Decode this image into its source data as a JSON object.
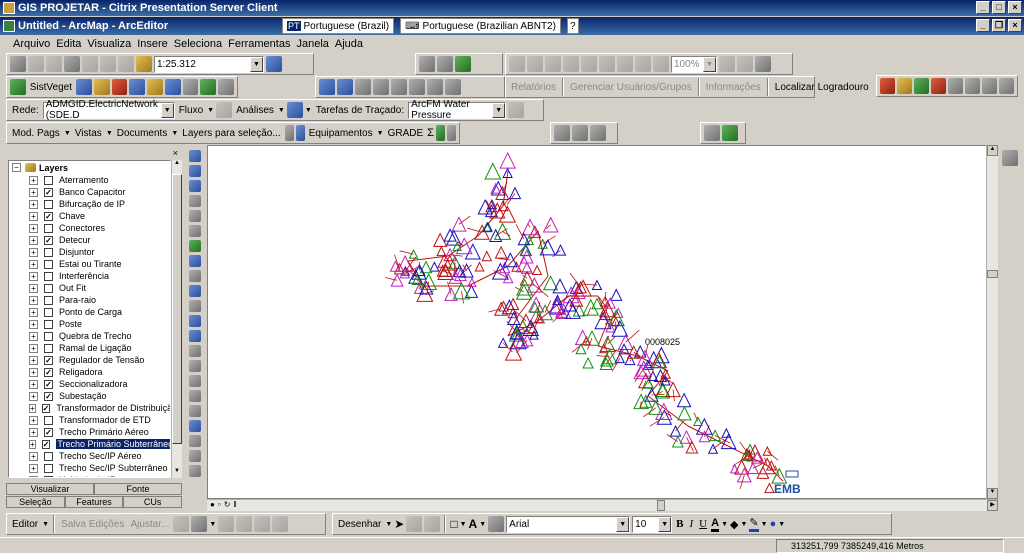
{
  "outer_title": "GIS PROJETAR - Citrix Presentation Server Client",
  "app_title": "Untitled - ArcMap - ArcEditor",
  "language_bar": [
    {
      "code": "PT",
      "label": "Portuguese (Brazil)"
    },
    {
      "code": "",
      "label": "Portuguese (Brazilian ABNT2)"
    }
  ],
  "menus": [
    "Arquivo",
    "Edita",
    "Visualiza",
    "Insere",
    "Seleciona",
    "Ferramentas",
    "Janela",
    "Ajuda"
  ],
  "standard_toolbar": {
    "scale": "1:25.312"
  },
  "sistveget_toolbar": {
    "label": "SistVeget"
  },
  "right_toolbar": {
    "zoom": "100%",
    "items": [
      "Relatórios",
      "Gerenciar Usuários/Grupos",
      "Informações",
      "Localizar Logradouro"
    ]
  },
  "network_toolbar": {
    "rede_label": "Rede:",
    "network": "ADMGID.ElectricNetwork (SDE.D",
    "fluxo": "Fluxo",
    "analises": "Análises",
    "tarefas_label": "Tarefas de Traçado:",
    "tarefa": "ArcFM Water Pressure"
  },
  "mod_toolbar": {
    "items": [
      "Mod. Pags",
      "Vistas",
      "Documents",
      "Layers para seleção...",
      "Equipamentos",
      "GRADE"
    ]
  },
  "toc": {
    "root": "Layers",
    "layers": [
      {
        "name": "Aterramento",
        "checked": false
      },
      {
        "name": "Banco Capacitor",
        "checked": true
      },
      {
        "name": "Bifurcação de IP",
        "checked": false
      },
      {
        "name": "Chave",
        "checked": true
      },
      {
        "name": "Conectores",
        "checked": false
      },
      {
        "name": "Detecur",
        "checked": true
      },
      {
        "name": "Disjuntor",
        "checked": false
      },
      {
        "name": "Estai ou Tirante",
        "checked": false
      },
      {
        "name": "Interferência",
        "checked": false
      },
      {
        "name": "Out Fit",
        "checked": false
      },
      {
        "name": "Para-raio",
        "checked": false
      },
      {
        "name": "Ponto de Carga",
        "checked": false
      },
      {
        "name": "Poste",
        "checked": false
      },
      {
        "name": "Quebra de Trecho",
        "checked": false
      },
      {
        "name": "Ramal de Ligação",
        "checked": false
      },
      {
        "name": "Regulador de Tensão",
        "checked": true
      },
      {
        "name": "Religadora",
        "checked": true
      },
      {
        "name": "Seccionalizadora",
        "checked": true
      },
      {
        "name": "Subestação",
        "checked": true
      },
      {
        "name": "Transformador de Distribuição",
        "checked": true
      },
      {
        "name": "Transformador de ETD",
        "checked": false
      },
      {
        "name": "Trecho Primário Aéreo",
        "checked": true
      },
      {
        "name": "Trecho Primário Subterrâneo",
        "checked": true,
        "selected": true
      },
      {
        "name": "Trecho Sec/IP Aéreo",
        "checked": false
      },
      {
        "name": "Trecho Sec/IP Subterrâneo",
        "checked": false
      },
      {
        "name": "Unidade de IP",
        "checked": false
      }
    ],
    "tabs_row1": [
      "Visualizar",
      "Fonte"
    ],
    "tabs_row2": [
      "Seleção",
      "Features",
      "CUs"
    ]
  },
  "map": {
    "label_point": "0008025",
    "label_sub": "EMB"
  },
  "editor_toolbar": {
    "editor": "Editor",
    "save": "Salva Edições",
    "adjust": "Ajustar..."
  },
  "draw_toolbar": {
    "desenhar": "Desenhar",
    "font": "Arial",
    "size": "10",
    "bold": "B",
    "italic": "I",
    "underline": "U"
  },
  "status": {
    "coords": "313251,799  7385249,416 Metros"
  }
}
